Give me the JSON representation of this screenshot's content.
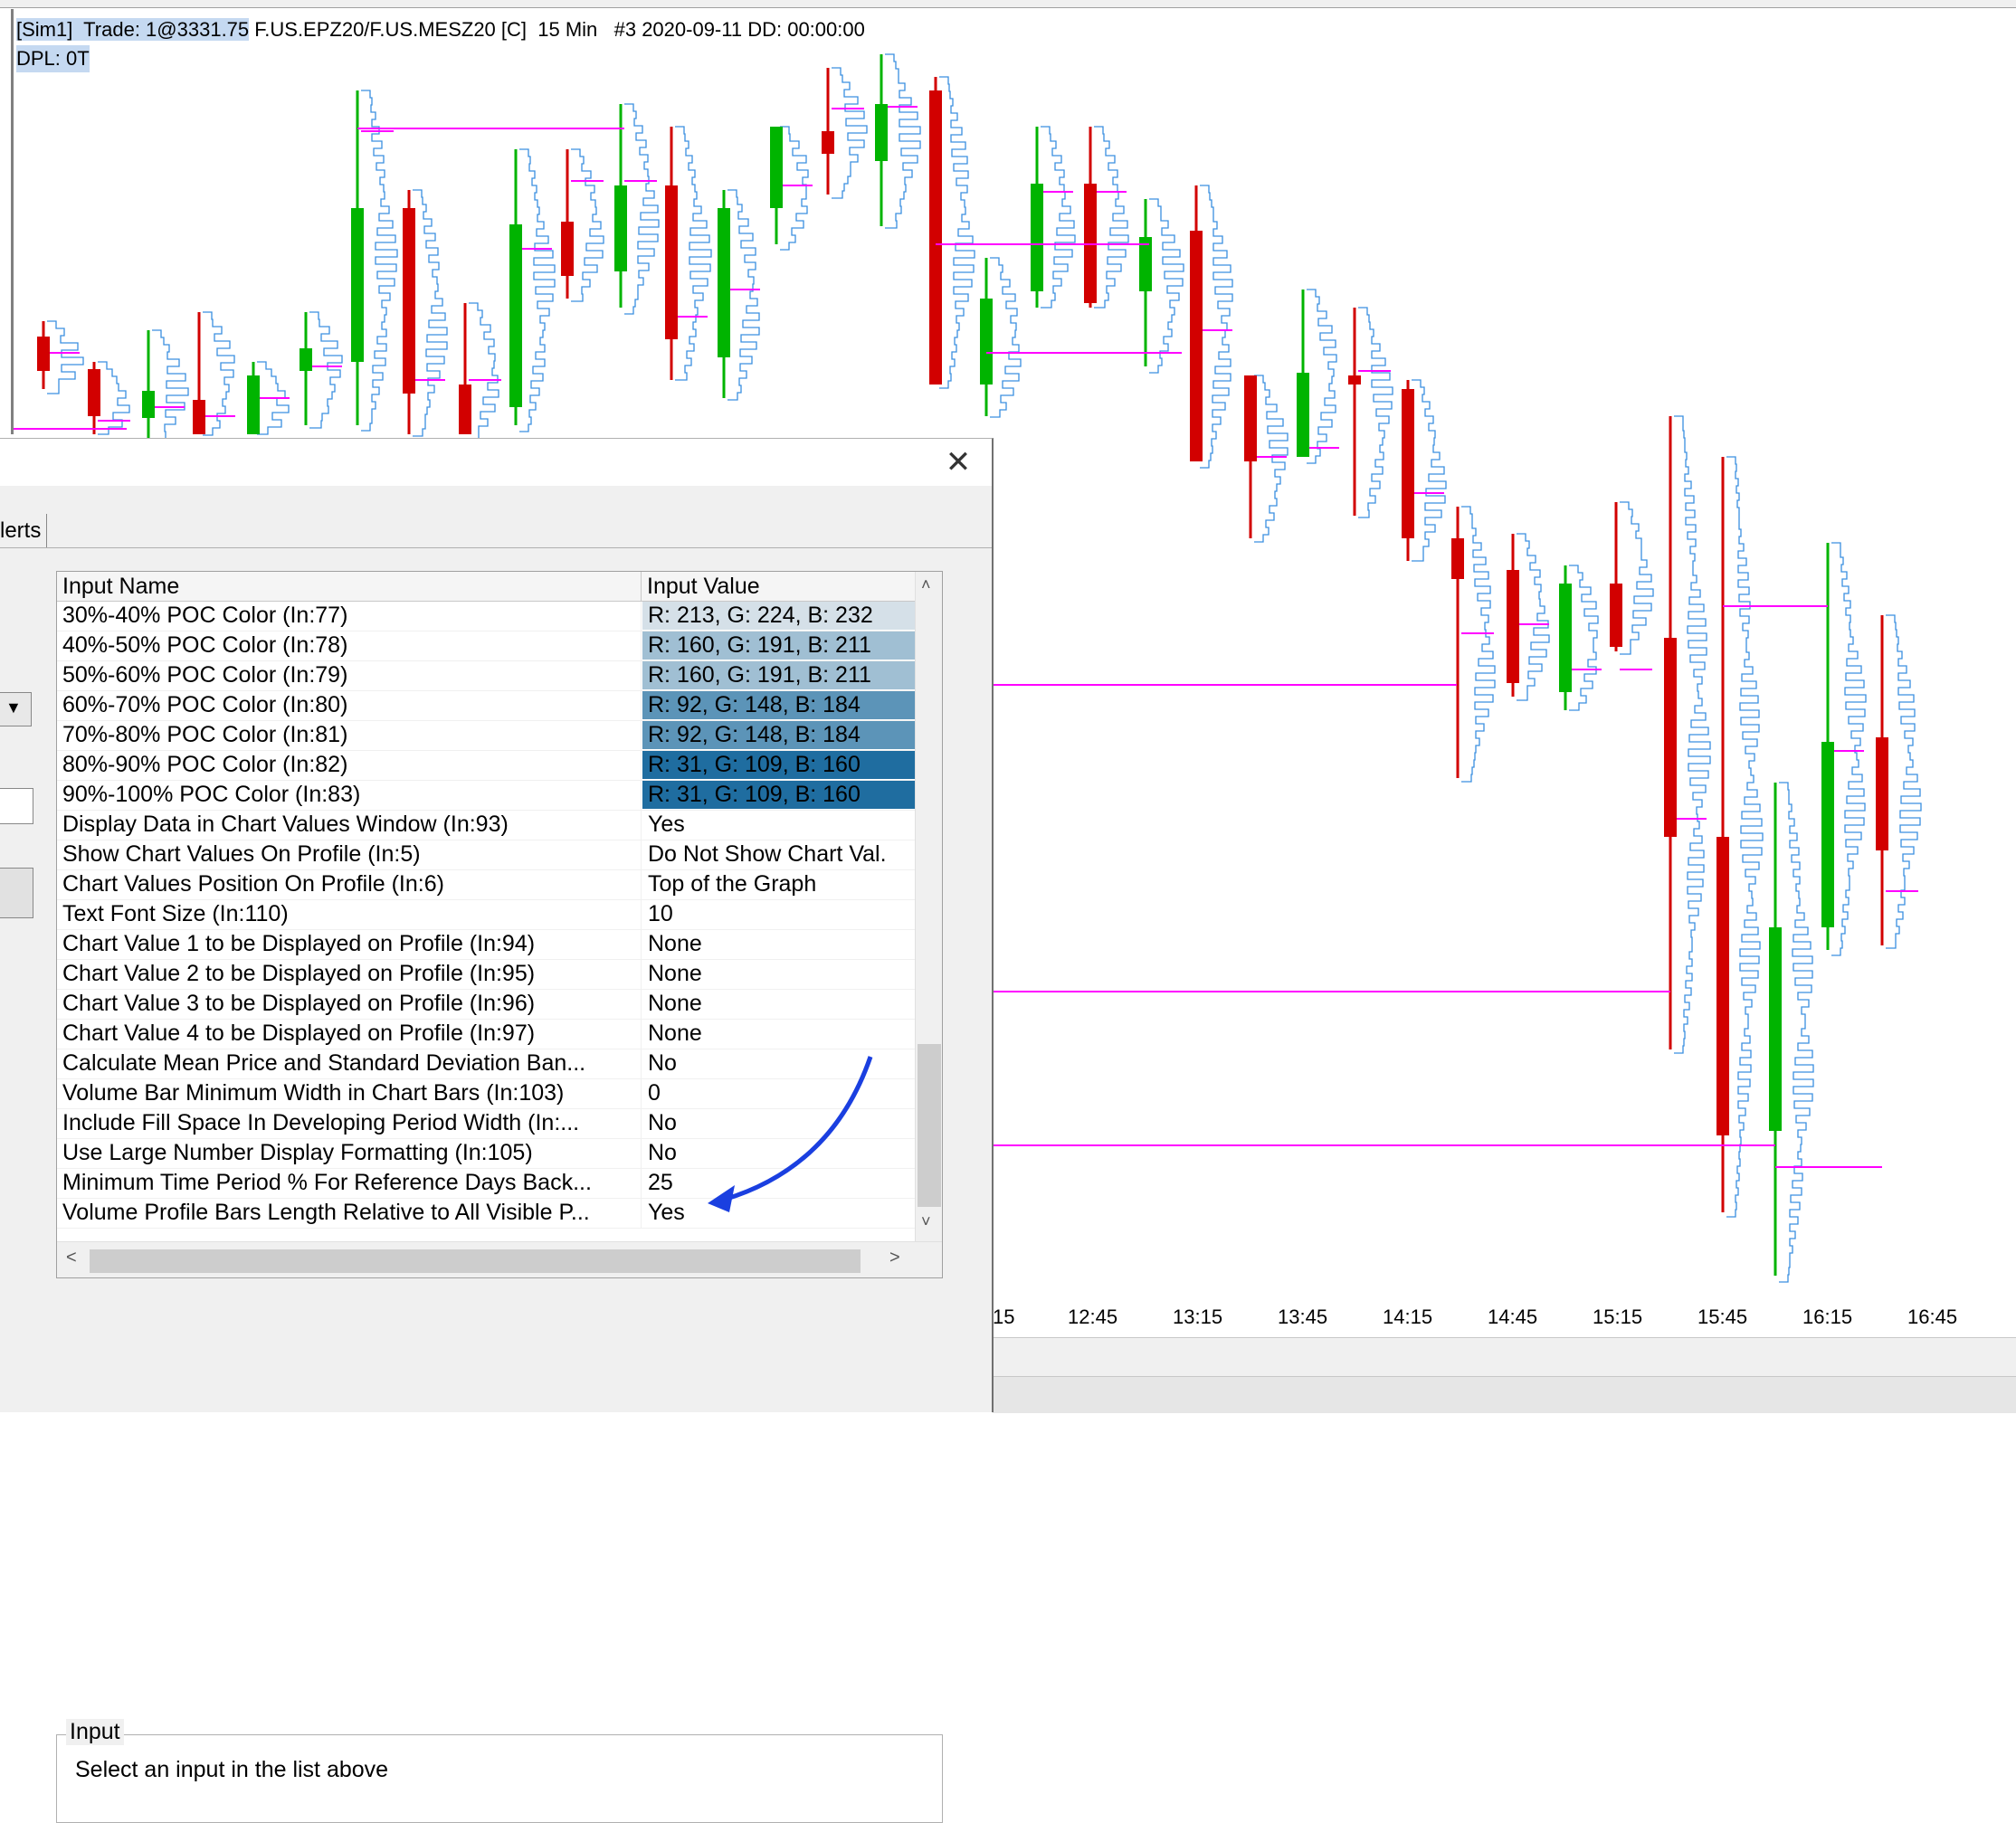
{
  "chart": {
    "header_line1_highlight": "[Sim1]  Trade: 1@3331.75",
    "header_line1_rest": " F.US.EPZ20/F.US.MESZ20 [C]  15 Min   #3 2020-09-11 DD: 00:00:00",
    "header_line2": "DPL: 0T",
    "time_labels": [
      "15",
      "12:45",
      "13:15",
      "13:45",
      "14:15",
      "14:45",
      "15:15",
      "15:45",
      "16:15",
      "16:45"
    ],
    "colors": {
      "up": "#00b400",
      "down": "#d20000",
      "profile": "#3a8fe0",
      "poc_line": "#ff00ff"
    }
  },
  "dialog": {
    "close_glyph": "✕",
    "tab_alerts": "lerts",
    "dropdown_glyph": "▼",
    "grid": {
      "col_name": "Input Name",
      "col_value": "Input Value",
      "rows": [
        {
          "name": "30%-40% POC Color   (In:77)",
          "value": "R: 213, G: 224, B: 232",
          "bg": "#d5e0e8",
          "fg": "#000000"
        },
        {
          "name": "40%-50% POC Color   (In:78)",
          "value": "R: 160, G: 191, B: 211",
          "bg": "#a0bfd3",
          "fg": "#000000"
        },
        {
          "name": "50%-60% POC Color   (In:79)",
          "value": "R: 160, G: 191, B: 211",
          "bg": "#a0bfd3",
          "fg": "#000000"
        },
        {
          "name": "60%-70% POC Color   (In:80)",
          "value": "R: 92, G: 148, B: 184",
          "bg": "#5c94b8",
          "fg": "#000000"
        },
        {
          "name": "70%-80% POC Color   (In:81)",
          "value": "R: 92, G: 148, B: 184",
          "bg": "#5c94b8",
          "fg": "#000000"
        },
        {
          "name": "80%-90% POC Color   (In:82)",
          "value": "R: 31, G: 109, B: 160",
          "bg": "#1f6da0",
          "fg": "#000000"
        },
        {
          "name": "90%-100% POC Color   (In:83)",
          "value": "R: 31, G: 109, B: 160",
          "bg": "#1f6da0",
          "fg": "#000000"
        },
        {
          "name": "Display Data in Chart Values Window   (In:93)",
          "value": "Yes"
        },
        {
          "name": "Show Chart Values On Profile   (In:5)",
          "value": "Do Not Show Chart Val."
        },
        {
          "name": "Chart Values Position On Profile   (In:6)",
          "value": "Top of the Graph"
        },
        {
          "name": "Text Font Size   (In:110)",
          "value": "10"
        },
        {
          "name": "Chart Value 1 to be Displayed on Profile   (In:94)",
          "value": "None"
        },
        {
          "name": "Chart Value 2 to be Displayed on Profile   (In:95)",
          "value": "None"
        },
        {
          "name": "Chart Value 3 to be Displayed on Profile   (In:96)",
          "value": "None"
        },
        {
          "name": "Chart Value 4 to be Displayed on Profile   (In:97)",
          "value": "None"
        },
        {
          "name": "Calculate Mean Price and Standard Deviation Ban...",
          "value": "No"
        },
        {
          "name": "Volume Bar Minimum Width in Chart Bars   (In:103)",
          "value": "0"
        },
        {
          "name": "Include Fill Space In Developing Period Width   (In:...",
          "value": "No"
        },
        {
          "name": "Use Large Number Display Formatting   (In:105)",
          "value": "No"
        },
        {
          "name": "Minimum Time Period % For Reference Days Back...",
          "value": "25"
        },
        {
          "name": "Volume Profile Bars Length Relative to All Visible P...",
          "value": "Yes"
        }
      ],
      "scroll_up": "˄",
      "scroll_down": "˅",
      "scroll_left": "<",
      "scroll_right": ">"
    },
    "input_group": {
      "legend": "Input",
      "hint": "Select an input in the list above"
    },
    "annotation_color": "#1a3fe0"
  }
}
